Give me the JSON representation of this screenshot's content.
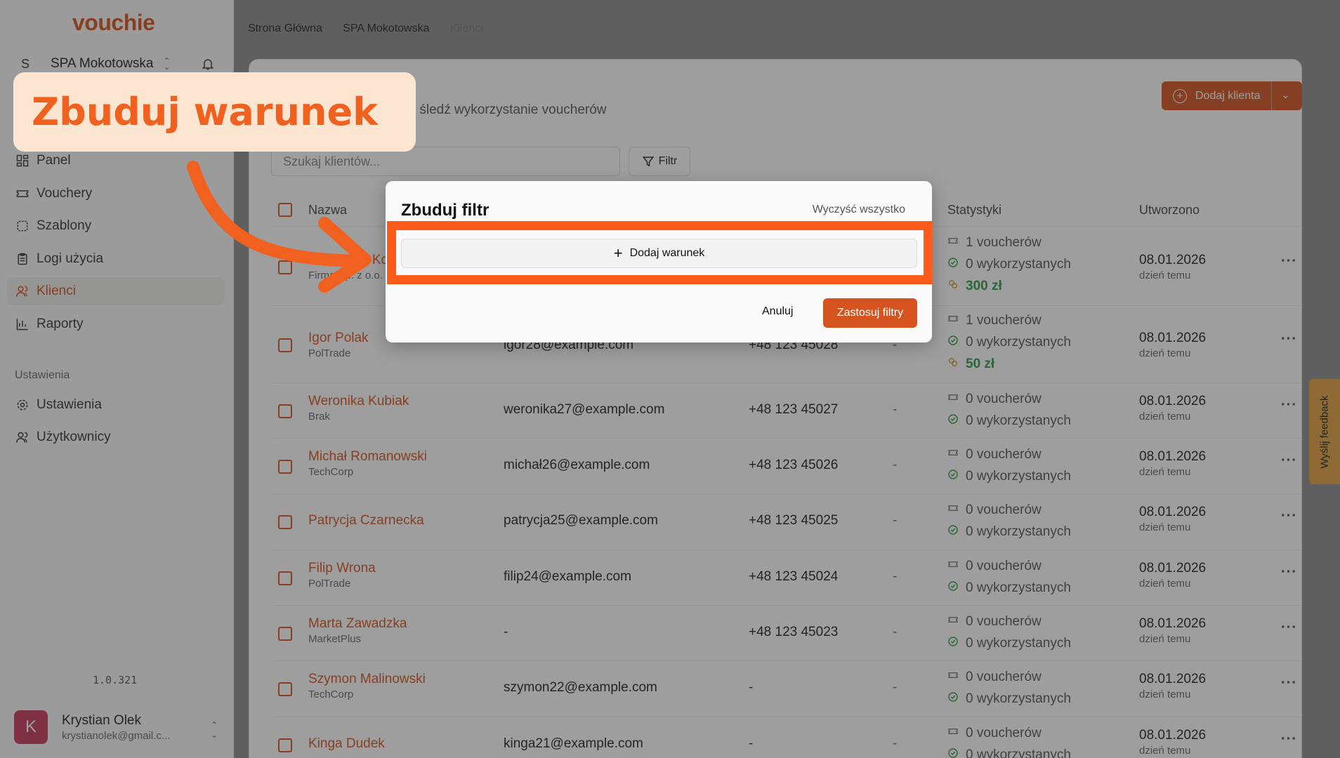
{
  "app": {
    "logo": "vouchie"
  },
  "sidebar": {
    "workspace_initial": "S",
    "workspace_name": "SPA Mokotowska",
    "items": [
      {
        "label": "Panel",
        "icon": "dashboard-icon"
      },
      {
        "label": "Vouchery",
        "icon": "ticket-icon"
      },
      {
        "label": "Szablony",
        "icon": "template-icon"
      },
      {
        "label": "Logi użycia",
        "icon": "clipboard-icon"
      },
      {
        "label": "Klienci",
        "icon": "users-icon",
        "active": true
      },
      {
        "label": "Raporty",
        "icon": "chart-icon"
      }
    ],
    "settings_section": "Ustawienia",
    "settings_items": [
      {
        "label": "Ustawienia",
        "icon": "gear-icon"
      },
      {
        "label": "Użytkownicy",
        "icon": "users-icon"
      }
    ],
    "version": "1.0.321",
    "user": {
      "initial": "K",
      "name": "Krystian Olek",
      "email": "krystianolek@gmail.c..."
    }
  },
  "breadcrumb": [
    "Strona Główna",
    "SPA Mokotowska",
    "Klienci"
  ],
  "header": {
    "subtitle_fragment": "ami i śledź wykorzystanie voucherów",
    "add_client": "Dodaj klienta"
  },
  "toolbar": {
    "search_placeholder": "Szukaj klientów...",
    "filter_label": "Filtr"
  },
  "table": {
    "columns": {
      "name": "Nazwa",
      "stats": "Statystyki",
      "created": "Utworzono"
    },
    "rows": [
      {
        "name": "Katarzyna Ko",
        "company": "Firma Sp. z o.o.",
        "email": "",
        "phone": "",
        "dash": "",
        "stats": [
          "1 voucherów",
          "0 wykorzystanych"
        ],
        "amount": "300 zł",
        "date": "08.01.2026",
        "ago": "dzień temu"
      },
      {
        "name": "Igor Polak",
        "company": "PolTrade",
        "email": "igor28@example.com",
        "phone": "+48 123 45028",
        "dash": "-",
        "stats": [
          "1 voucherów",
          "0 wykorzystanych"
        ],
        "amount": "50 zł",
        "date": "08.01.2026",
        "ago": "dzień temu"
      },
      {
        "name": "Weronika Kubiak",
        "company": "Brak",
        "email": "weronika27@example.com",
        "phone": "+48 123 45027",
        "dash": "-",
        "stats": [
          "0 voucherów",
          "0 wykorzystanych"
        ],
        "date": "08.01.2026",
        "ago": "dzień temu"
      },
      {
        "name": "Michał Romanowski",
        "company": "TechCorp",
        "email": "michał26@example.com",
        "phone": "+48 123 45026",
        "dash": "-",
        "stats": [
          "0 voucherów",
          "0 wykorzystanych"
        ],
        "date": "08.01.2026",
        "ago": "dzień temu"
      },
      {
        "name": "Patrycja Czarnecka",
        "company": "",
        "email": "patrycja25@example.com",
        "phone": "+48 123 45025",
        "dash": "-",
        "stats": [
          "0 voucherów",
          "0 wykorzystanych"
        ],
        "date": "08.01.2026",
        "ago": "dzień temu"
      },
      {
        "name": "Filip Wrona",
        "company": "PolTrade",
        "email": "filip24@example.com",
        "phone": "+48 123 45024",
        "dash": "-",
        "stats": [
          "0 voucherów",
          "0 wykorzystanych"
        ],
        "date": "08.01.2026",
        "ago": "dzień temu"
      },
      {
        "name": "Marta Zawadzka",
        "company": "MarketPlus",
        "email": "-",
        "phone": "+48 123 45023",
        "dash": "-",
        "stats": [
          "0 voucherów",
          "0 wykorzystanych"
        ],
        "date": "08.01.2026",
        "ago": "dzień temu"
      },
      {
        "name": "Szymon Malinowski",
        "company": "TechCorp",
        "email": "szymon22@example.com",
        "phone": "-",
        "dash": "-",
        "stats": [
          "0 voucherów",
          "0 wykorzystanych"
        ],
        "date": "08.01.2026",
        "ago": "dzień temu"
      },
      {
        "name": "Kinga Dudek",
        "company": "",
        "email": "kinga21@example.com",
        "phone": "-",
        "dash": "-",
        "stats": [
          "0 voucherów",
          "0 wykorzystanych"
        ],
        "date": "08.01.2026",
        "ago": "dzień temu"
      }
    ]
  },
  "filter_popover": {
    "title": "Zbuduj filtr",
    "clear_all": "Wyczyść wszystko",
    "add_condition": "Dodaj warunek",
    "cancel": "Anuluj",
    "apply": "Zastosuj filtry"
  },
  "annotation": {
    "callout": "Zbuduj warunek"
  },
  "feedback_tab": "Wyślij feedback",
  "colors": {
    "accent": "#d4531e",
    "highlight": "#ff5a19",
    "callout_bg": "#fde6d1",
    "money": "#2e9a4b",
    "feedback": "#e2a33f"
  }
}
